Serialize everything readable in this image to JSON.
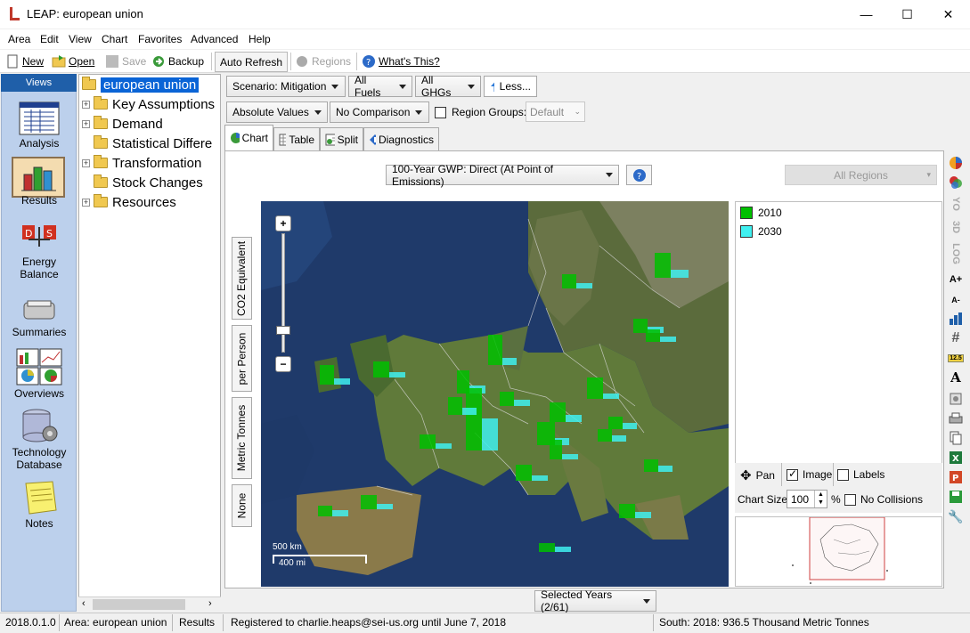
{
  "window": {
    "title": "LEAP: european union",
    "minimize": "—",
    "maximize": "☐",
    "close": "✕"
  },
  "menu": [
    "Area",
    "Edit",
    "View",
    "Chart",
    "Favorites",
    "Advanced",
    "Help"
  ],
  "toolbar": {
    "new": "New",
    "open": "Open",
    "save": "Save",
    "backup": "Backup",
    "auto_refresh": "Auto Refresh",
    "regions": "Regions",
    "whats_this": "What's This?"
  },
  "views": {
    "header": "Views",
    "items": [
      "Analysis",
      "Results",
      "Energy Balance",
      "Summaries",
      "Overviews",
      "Technology Database",
      "Notes"
    ]
  },
  "tree": {
    "root": "european union",
    "items": [
      "Key Assumptions",
      "Demand",
      "Statistical Differe",
      "Transformation",
      "Stock Changes",
      "Resources"
    ]
  },
  "filters": {
    "scenario": "Scenario: Mitigation",
    "fuels": "All Fuels",
    "ghgs": "All GHGs",
    "less": "Less...",
    "units": "Absolute Values",
    "comparison": "No Comparison",
    "region_groups_label": "Region Groups:",
    "region_groups_value": "Default"
  },
  "tabs": [
    "Chart",
    "Table",
    "Split",
    "Diagnostics"
  ],
  "chart": {
    "metric": "100-Year GWP: Direct (At Point of Emissions)",
    "regions": "All Regions",
    "vertical_buttons": [
      "CO2 Equivalent",
      "per Person",
      "Metric Tonnes",
      "None"
    ],
    "scale_km": "500 km",
    "scale_mi": "400 mi",
    "zoom_in": "+",
    "zoom_out": "−",
    "legend": [
      {
        "label": "2010",
        "color": "#00c000"
      },
      {
        "label": "2030",
        "color": "#40f0f0"
      }
    ],
    "pan": "Pan",
    "image": "Image",
    "labels": "Labels",
    "chart_size_label": "Chart Size:",
    "chart_size_value": "100",
    "percent": "%",
    "no_collisions": "No Collisions",
    "selected_years": "Selected Years (2/61)"
  },
  "right_tools": [
    "YO",
    "3D",
    "LOG",
    "A+",
    "A-",
    "12.5"
  ],
  "status": {
    "version": "2018.0.1.0",
    "area": "Area: european union",
    "view": "Results",
    "registration": "Registered to charlie.heaps@sei-us.org until June 7, 2018",
    "info": "South: 2018: 936.5 Thousand Metric Tonnes"
  }
}
